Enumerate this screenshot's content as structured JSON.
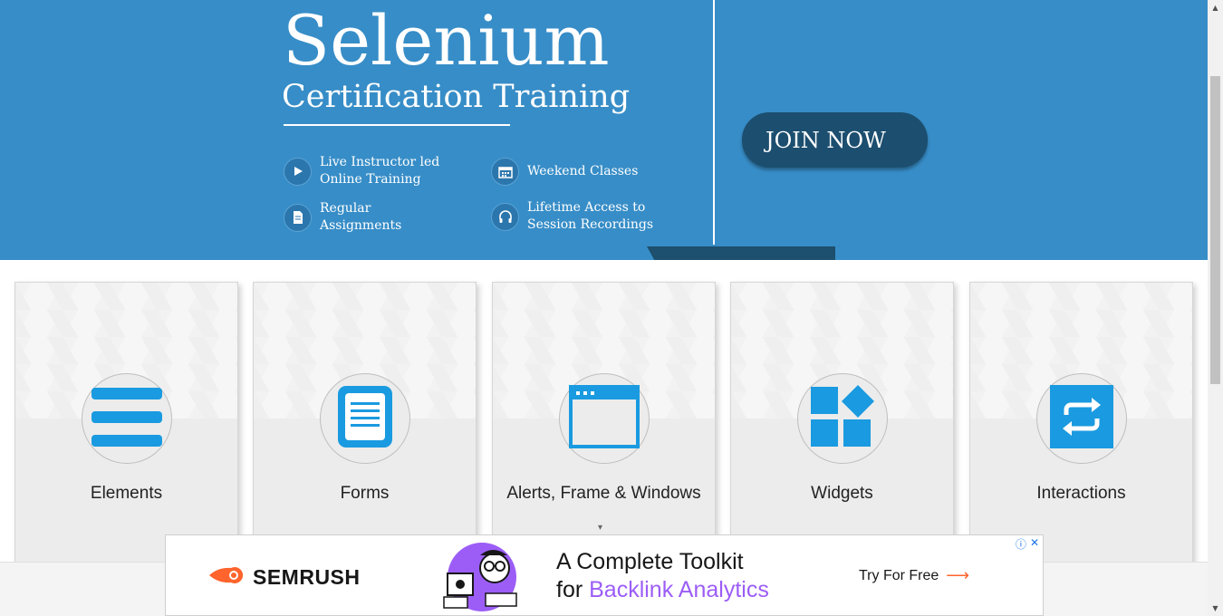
{
  "banner": {
    "title": "Selenium",
    "subtitle": "Certification Training",
    "features": [
      {
        "icon": "play-icon",
        "text": "Live Instructor led Online Training"
      },
      {
        "icon": "calendar-icon",
        "text": "Weekend Classes"
      },
      {
        "icon": "document-icon",
        "text": "Regular Assignments"
      },
      {
        "icon": "headphones-icon",
        "text": "Lifetime Access to Session Recordings"
      }
    ],
    "cta_label": "JOIN NOW",
    "background_color": "#378dc7",
    "button_color": "#1c4e6f"
  },
  "cards": [
    {
      "label": "Elements",
      "icon": "hamburger-icon"
    },
    {
      "label": "Forms",
      "icon": "form-document-icon"
    },
    {
      "label": "Alerts, Frame & Windows",
      "icon": "browser-window-icon"
    },
    {
      "label": "Widgets",
      "icon": "widgets-icon"
    },
    {
      "label": "Interactions",
      "icon": "swap-arrows-icon"
    }
  ],
  "card_icon_color": "#1a9ae0",
  "ad": {
    "brand": "SEMRUSH",
    "headline_line1": "A Complete Toolkit",
    "headline_line2_prefix": "for ",
    "headline_line2_accent": "Backlink Analytics",
    "cta_label": "Try For Free",
    "accent_color": "#9c5df6",
    "brand_color": "#ff642d"
  }
}
